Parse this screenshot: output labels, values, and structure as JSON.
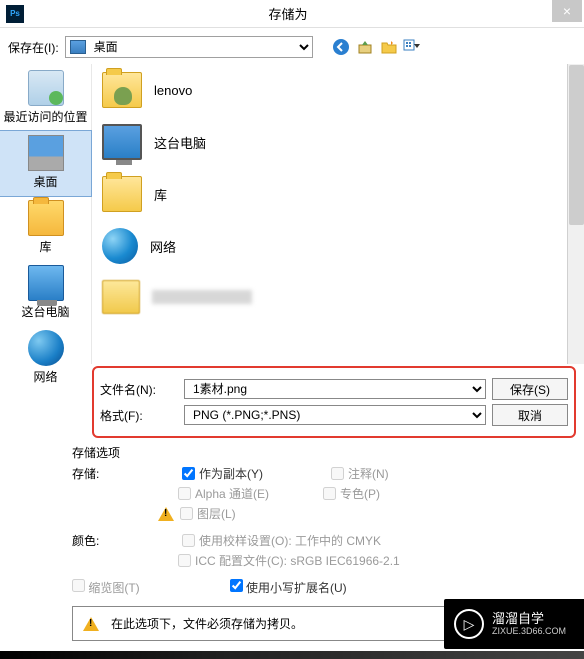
{
  "title": "存储为",
  "close": "×",
  "ps_icon": "Ps",
  "top": {
    "save_in_label": "保存在(I):",
    "location": "桌面"
  },
  "nav": {
    "back": "←",
    "up": "↥",
    "newfolder": "📂",
    "view": "▦▾"
  },
  "sidebar": [
    {
      "label": "最近访问的位置",
      "icon": "recent"
    },
    {
      "label": "桌面",
      "icon": "desktop"
    },
    {
      "label": "库",
      "icon": "lib"
    },
    {
      "label": "这台电脑",
      "icon": "pc"
    },
    {
      "label": "网络",
      "icon": "net"
    }
  ],
  "files": [
    {
      "label": "lenovo",
      "type": "user"
    },
    {
      "label": "这台电脑",
      "type": "pc"
    },
    {
      "label": "库",
      "type": "folder"
    },
    {
      "label": "网络",
      "type": "net"
    },
    {
      "label": "",
      "type": "blur"
    }
  ],
  "form": {
    "filename_label": "文件名(N):",
    "filename": "1素材.png",
    "format_label": "格式(F):",
    "format": "PNG (*.PNG;*.PNS)",
    "save_btn": "保存(S)",
    "cancel_btn": "取消"
  },
  "options": {
    "header": "存储选项",
    "store": "存储:",
    "as_copy": "作为副本(Y)",
    "notes": "注释(N)",
    "alpha": "Alpha 通道(E)",
    "spot": "专色(P)",
    "layers": "图层(L)",
    "color": "颜色:",
    "proof": "使用校样设置(O):  工作中的 CMYK",
    "icc": "ICC 配置文件(C):  sRGB IEC61966-2.1",
    "thumb": "缩览图(T)",
    "lower_ext": "使用小写扩展名(U)",
    "warn_text": "在此选项下，文件必须存储为拷贝。"
  },
  "watermark": {
    "brand": "溜溜自学",
    "url": "ZIXUE.3D66.COM",
    "play": "▷"
  }
}
